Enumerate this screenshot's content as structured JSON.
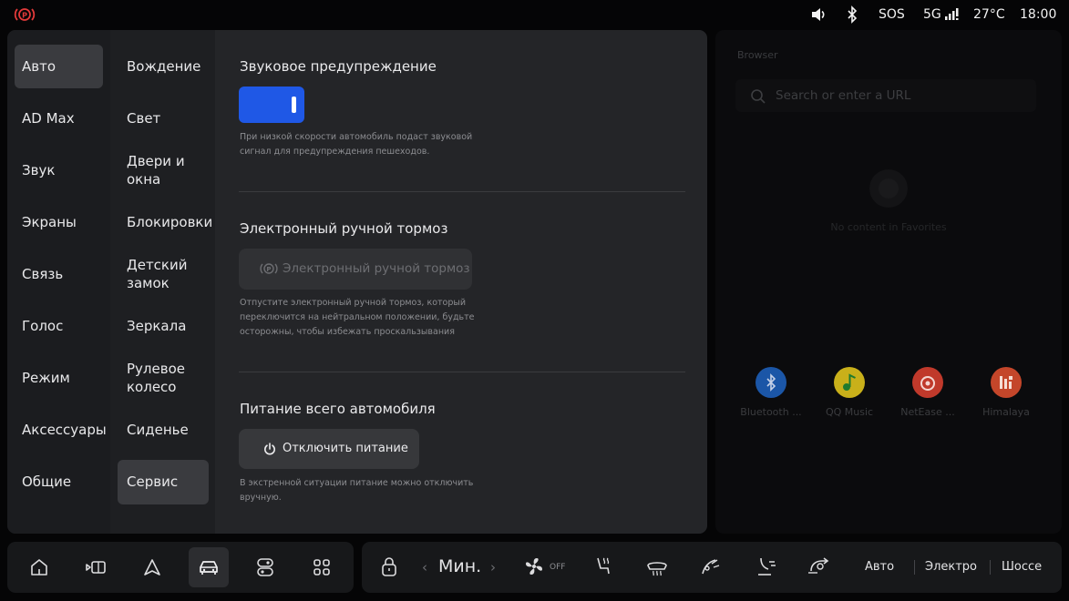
{
  "status_bar": {
    "icons": [
      "parking-brake-icon",
      "volume-icon",
      "bluetooth-icon",
      "signal-icon"
    ],
    "sos": "SOS",
    "network": "5G",
    "temperature": "27°C",
    "time": "18:00",
    "brake_color": "#e23a3a"
  },
  "categories": [
    {
      "label": "Авто",
      "active": true
    },
    {
      "label": "AD Max"
    },
    {
      "label": "Звук"
    },
    {
      "label": "Экраны"
    },
    {
      "label": "Связь"
    },
    {
      "label": "Голос"
    },
    {
      "label": "Режим"
    },
    {
      "label": "Аксессуары"
    },
    {
      "label": "Общие"
    }
  ],
  "subcategories": [
    {
      "label": "Вождение"
    },
    {
      "label": "Свет"
    },
    {
      "label": "Двери и окна"
    },
    {
      "label": "Блокировки"
    },
    {
      "label": "Детский замок"
    },
    {
      "label": "Зеркала"
    },
    {
      "label": "Рулевое колесо"
    },
    {
      "label": "Сиденье"
    },
    {
      "label": "Сервис",
      "active": true
    }
  ],
  "sections": {
    "sound_warning": {
      "title": "Звуковое предупреждение",
      "toggle_on": true,
      "description": "При низкой скорости автомобиль подаст звуковой сигнал для предупреждения пешеходов."
    },
    "parking_brake": {
      "title": "Электронный ручной тормоз",
      "button_label": "Электронный ручной тормоз",
      "description": "Отпустите электронный ручной тормоз, который переключится на нейтральном положении, будьте осторожны, чтобы избежать проскальзывания"
    },
    "power": {
      "title": "Питание всего автомобиля",
      "button_label": "Отключить питание",
      "description": "В экстренной ситуации питание можно отключить вручную."
    }
  },
  "browser": {
    "title": "Browser",
    "search_placeholder": "Search or enter a URL",
    "empty_text": "No content in Favorites",
    "apps": [
      {
        "label": "Bluetooth ...",
        "icon": "bluetooth-app-icon",
        "color": "#1d5fb8"
      },
      {
        "label": "QQ Music",
        "icon": "qq-music-icon",
        "color": "#c9b01a"
      },
      {
        "label": "NetEase ...",
        "icon": "netease-music-icon",
        "color": "#c0392b"
      },
      {
        "label": "Himalaya",
        "icon": "himalaya-icon",
        "color": "#c4462a"
      }
    ]
  },
  "dock": {
    "nav_icons": [
      "home-icon",
      "car-screen-icon",
      "navigation-icon",
      "vehicle-icon",
      "toggle-icon",
      "apps-grid-icon"
    ],
    "active_nav": "vehicle-icon",
    "fan_speed": "Мин.",
    "fan_state": "OFF",
    "modes": [
      "Авто",
      "Электро",
      "Шоссе"
    ]
  }
}
